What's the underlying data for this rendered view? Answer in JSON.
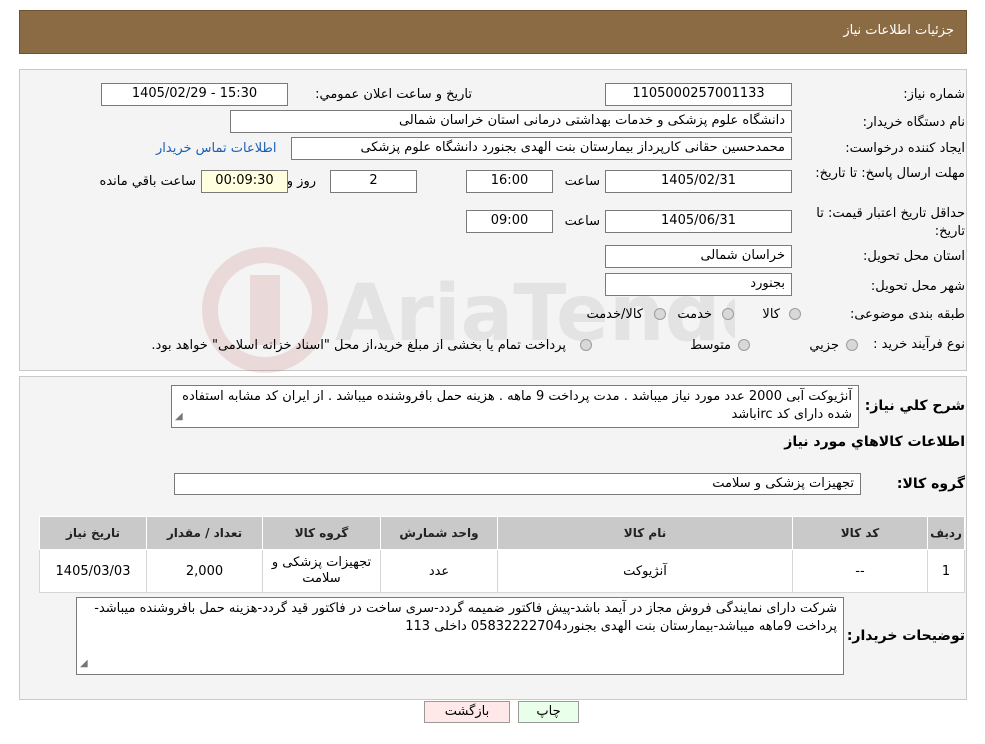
{
  "header": {
    "title": "جزئیات اطلاعات نیاز"
  },
  "form": {
    "need_number_label": "شماره نیاز:",
    "need_number": "1105000257001133",
    "announce_label": "تاریخ و ساعت اعلان عمومي:",
    "announce_value": "1405/02/29 - 15:30",
    "buyer_org_label": "نام دستگاه خريدار:",
    "buyer_org": "دانشگاه علوم پزشکی و خدمات بهداشتی درمانی استان خراسان شمالی",
    "requester_label": "ايجاد کننده درخواست:",
    "requester": "محمدحسین حقانی کارپرداز بیمارستان بنت الهدی بجنورد دانشگاه علوم پزشکی",
    "contact_link": "اطلاعات تماس خريدار",
    "deadline_label": "مهلت ارسال پاسخ: تا تاريخ:",
    "deadline_date": "1405/02/31",
    "time_label": "ساعت",
    "deadline_time": "16:00",
    "days_value": "2",
    "days_label": "روز و",
    "remaining_value": "00:09:30",
    "remaining_label": "ساعت باقي مانده",
    "validity_label": "حداقل تاريخ اعتبار قيمت: تا تاريخ:",
    "validity_date": "1405/06/31",
    "validity_time": "09:00",
    "province_label": "استان محل تحويل:",
    "province": "خراسان شمالی",
    "city_label": "شهر محل تحويل:",
    "city": "بجنورد",
    "category_label": "طبقه بندی موضوعی:",
    "category_options": [
      "کالا",
      "خدمت",
      "کالا/خدمت"
    ],
    "process_label": "نوع فرآيند خريد :",
    "process_options": [
      "جزيي",
      "متوسط"
    ],
    "process_note": "پرداخت تمام يا بخشی از مبلغ خريد،از محل \"اسناد خزانه اسلامی\" خواهد بود."
  },
  "summary": {
    "label": "شرح كلي نياز:",
    "text": "آنژیوکت آبی 2000 عدد مورد نیاز میباشد .  مدت پرداخت 9 ماهه . هزینه حمل بافروشنده میباشد .  از ایران کد مشابه استفاده شده دارای کد ircباشد"
  },
  "goods": {
    "section_title": "اطلاعات كالاهاي مورد نياز",
    "group_label": "گروه كالا:",
    "group_value": "تجهیزات پزشکی و سلامت",
    "columns": [
      "رديف",
      "كد كالا",
      "نام كالا",
      "واحد شمارش",
      "گروه كالا",
      "تعداد / مقدار",
      "تاريخ نياز"
    ],
    "rows": [
      [
        "1",
        "--",
        "آنژیوکت",
        "عدد",
        "تجهيزات پزشکی و سلامت",
        "2,000",
        "1405/03/03"
      ]
    ]
  },
  "buyer_notes": {
    "label": "توضيحات خريدار:",
    "text": "شرکت دارای نمایندگی فروش مجاز در آیمد باشد-پیش فاکتور ضمیمه گردد-سری ساخت در فاکتور قید گردد-هزینه حمل بافروشنده میباشد-پرداخت 9ماهه میباشد-بیمارستان بنت الهدی بجنورد05832222704 داخلی 113"
  },
  "buttons": {
    "print": "چاپ",
    "back": "بازگشت"
  },
  "colors": {
    "header_bg": "#8b6b43",
    "remaining_bg": "#ffffe0",
    "print_bg": "#eaffea",
    "back_bg": "#ffe8e8",
    "link": "#1a5fb4"
  }
}
